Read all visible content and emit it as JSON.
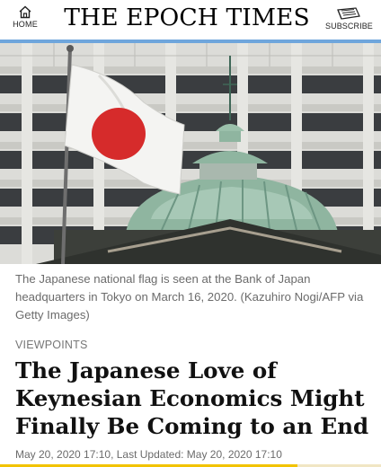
{
  "header": {
    "home_label": "HOME",
    "logo_text": "THE EPOCH TIMES",
    "subscribe_label": "SUBSCRIBE",
    "home_icon": "home-icon",
    "subscribe_icon": "newspaper-icon"
  },
  "hero": {
    "caption": "The Japanese national flag is seen at the Bank of Japan headquarters in Tokyo on March 16, 2020. (Kazuhiro Nogi/AFP via Getty Images)"
  },
  "article": {
    "category": "VIEWPOINTS",
    "title": "The Japanese Love of Keynesian Economics Might Finally Be Coming to an End",
    "dateline": "May 20, 2020 17:10, Last Updated: May 20, 2020 17:10"
  },
  "reading_progress": {
    "fraction": 0.78,
    "color": "#f2c300"
  },
  "colors": {
    "flag_red": "#d62b2b",
    "dome_green": "#8fb5a0"
  }
}
